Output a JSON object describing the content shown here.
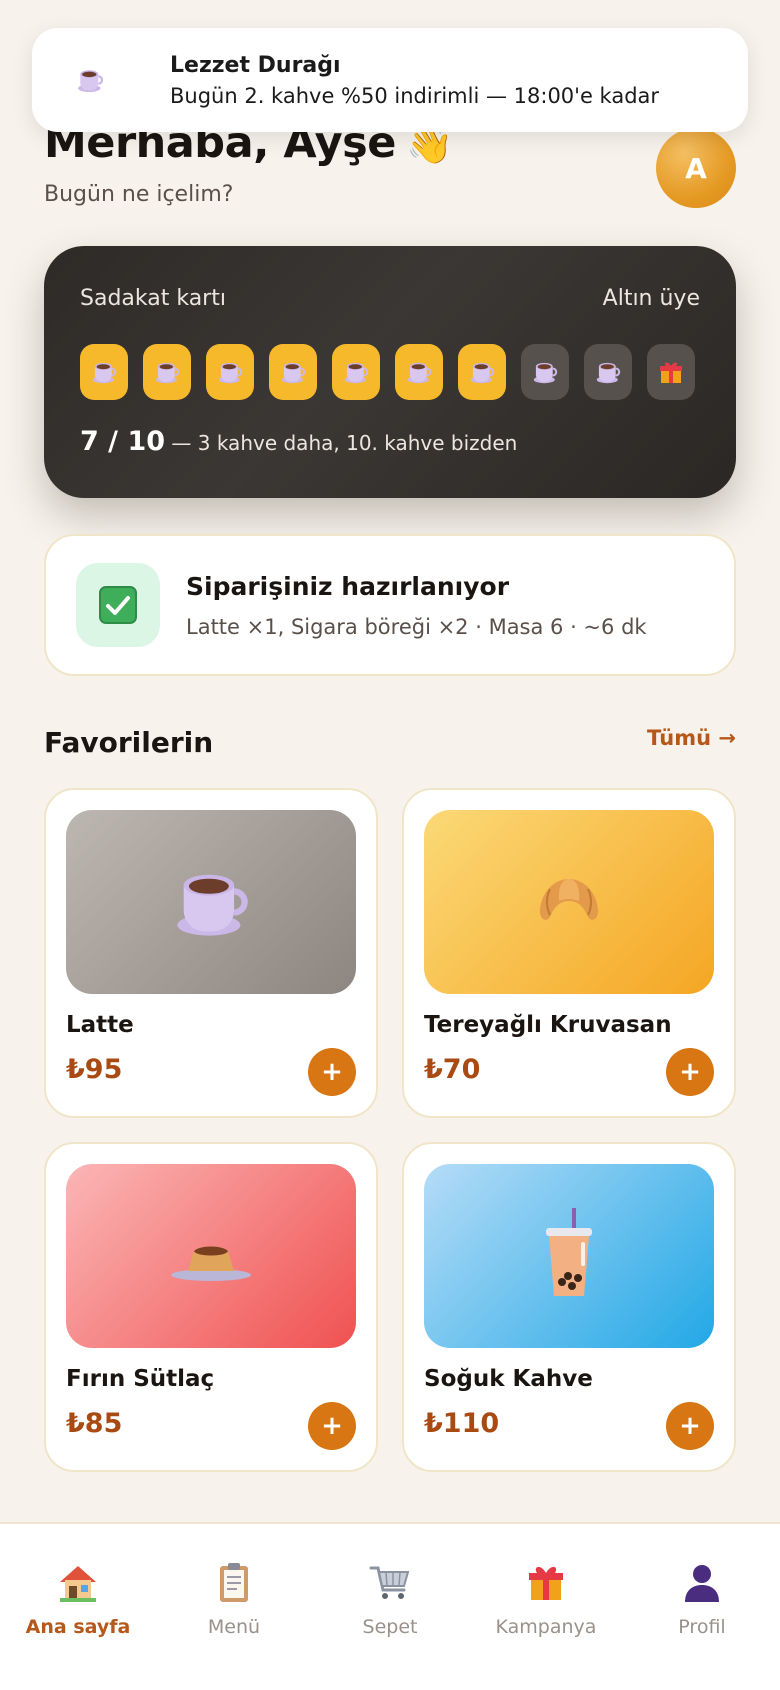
{
  "notification": {
    "title": "Lezzet Durağı",
    "body": "Bugün 2. kahve %50 indirimli — 18:00'e kadar",
    "icon": "coffee-cup-icon"
  },
  "header": {
    "greeting": "Merhaba, Ayşe",
    "wave_emoji": "👋",
    "subtitle": "Bugün ne içelim?",
    "avatar_initial": "A"
  },
  "loyalty": {
    "title": "Sadakat kartı",
    "tier": "Altın üye",
    "progress_count": "7 / 10",
    "progress_text": "— 3 kahve daha, 10. kahve bizden",
    "stamps_filled": 7,
    "stamps_total": 10,
    "colors": {
      "filled": "#f7b92c",
      "empty": "#56514d"
    }
  },
  "order": {
    "title": "Siparişiniz hazırlanıyor",
    "detail": "Latte ×1, Sigara böreği ×2 · Masa 6 · ~6 dk",
    "icon": "checkmark-icon"
  },
  "favorites": {
    "title": "Favorilerin",
    "see_all": "Tümü →",
    "items": [
      {
        "name": "Latte",
        "price": "₺95",
        "icon": "coffee-cup-icon",
        "add_label": "+"
      },
      {
        "name": "Tereyağlı Kruvasan",
        "price": "₺70",
        "icon": "croissant-icon",
        "add_label": "+"
      },
      {
        "name": "Fırın Sütlaç",
        "price": "₺85",
        "icon": "pudding-icon",
        "add_label": "+"
      },
      {
        "name": "Soğuk Kahve",
        "price": "₺110",
        "icon": "iced-coffee-icon",
        "add_label": "+"
      }
    ]
  },
  "nav": {
    "items": [
      {
        "label": "Ana sayfa",
        "icon": "home-icon",
        "active": true
      },
      {
        "label": "Menü",
        "icon": "clipboard-icon",
        "active": false
      },
      {
        "label": "Sepet",
        "icon": "cart-icon",
        "active": false
      },
      {
        "label": "Kampanya",
        "icon": "gift-icon",
        "active": false
      },
      {
        "label": "Profil",
        "icon": "user-icon",
        "active": false
      }
    ]
  },
  "colors": {
    "accent": "#d77612",
    "accent_text": "#b5581a",
    "background": "#f7f3ec",
    "card_dark": "#2e2a27"
  }
}
